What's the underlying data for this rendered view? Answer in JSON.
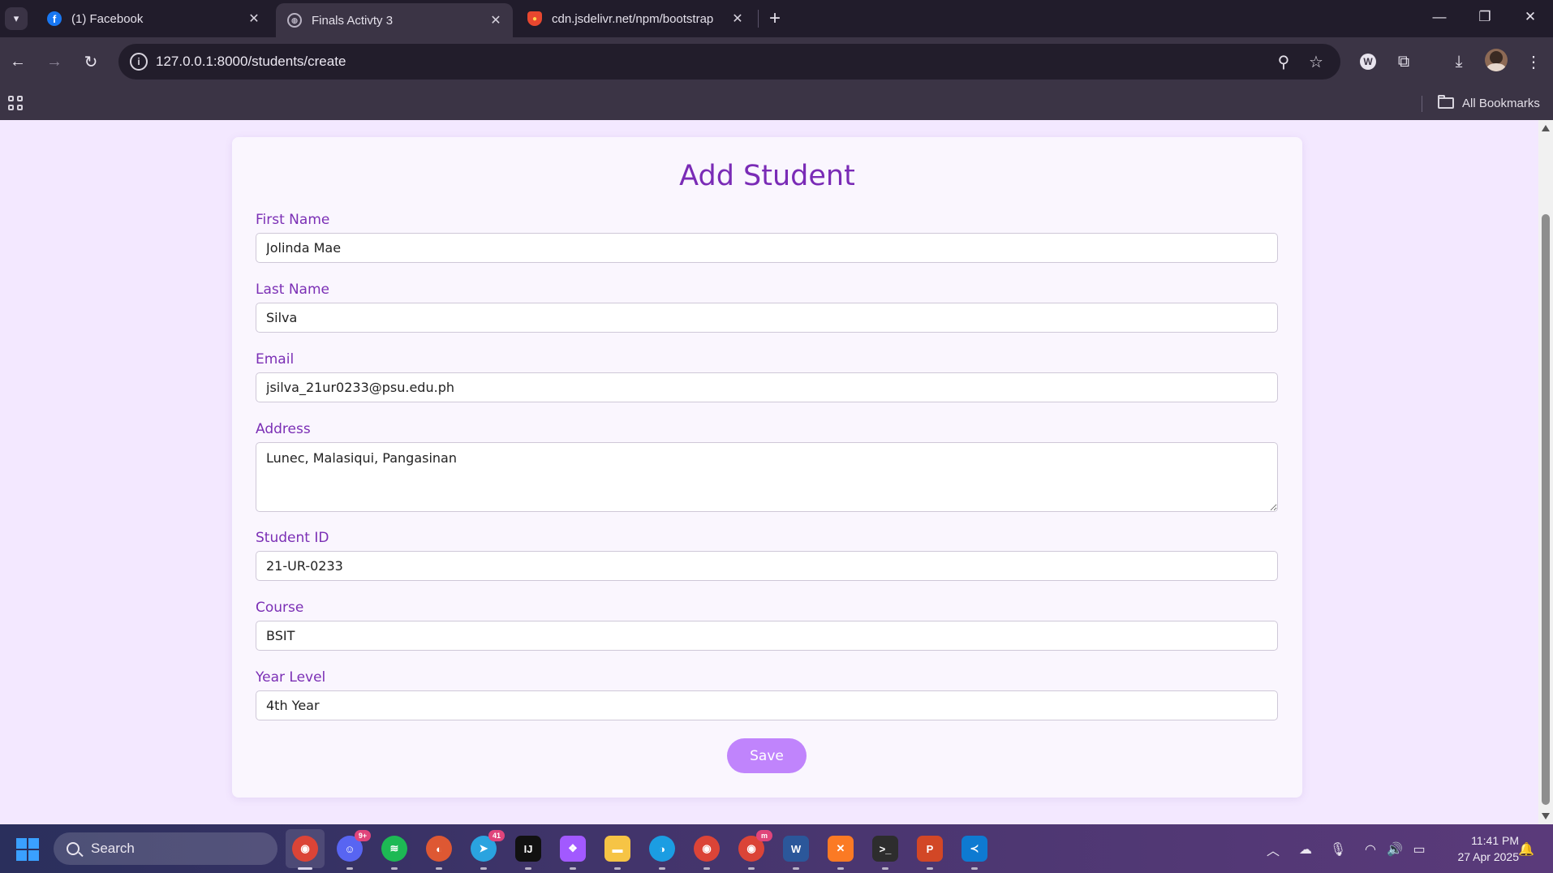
{
  "browser": {
    "tabs": [
      {
        "title": "(1) Facebook",
        "favicon": "facebook-icon",
        "favicon_color": "#1877f2"
      },
      {
        "title": "Finals Activty 3",
        "favicon": "globe-icon",
        "favicon_color": "#9a94a6"
      },
      {
        "title": "cdn.jsdelivr.net/npm/bootstrap",
        "favicon": "shield-icon",
        "favicon_color": "#e8472f"
      }
    ],
    "url": "127.0.0.1:8000/students/create",
    "bookmarks_label": "All Bookmarks"
  },
  "form": {
    "title": "Add Student",
    "fields": [
      {
        "label": "First Name",
        "value": "Jolinda Mae"
      },
      {
        "label": "Last Name",
        "value": "Silva"
      },
      {
        "label": "Email",
        "value": "jsilva_21ur0233@psu.edu.ph"
      },
      {
        "label": "Address",
        "value": "Lunec, Malasiqui, Pangasinan"
      },
      {
        "label": "Student ID",
        "value": "21-UR-0233"
      },
      {
        "label": "Course",
        "value": "BSIT"
      },
      {
        "label": "Year Level",
        "value": "4th Year"
      }
    ],
    "save_label": "Save",
    "accent_color": "#7a2bb6",
    "button_color": "#c084fc"
  },
  "taskbar": {
    "search_placeholder": "Search",
    "apps": [
      {
        "name": "chrome",
        "color": "#db4437"
      },
      {
        "name": "discord",
        "color": "#5865f2",
        "badge": "9+"
      },
      {
        "name": "spotify",
        "color": "#1db954"
      },
      {
        "name": "duckduckgo",
        "color": "#de5833"
      },
      {
        "name": "telegram",
        "color": "#2aa3df",
        "badge": "41"
      },
      {
        "name": "intellij",
        "color": "#111111"
      },
      {
        "name": "figma",
        "color": "#a259ff"
      },
      {
        "name": "file-explorer",
        "color": "#f6c445"
      },
      {
        "name": "edge",
        "color": "#1b9de2"
      },
      {
        "name": "chrome-profile-2",
        "color": "#db4437"
      },
      {
        "name": "chrome-profile-3",
        "color": "#db4437",
        "badge": "m"
      },
      {
        "name": "word",
        "color": "#2b579a"
      },
      {
        "name": "xampp",
        "color": "#fb7a24"
      },
      {
        "name": "terminal",
        "color": "#2d2d2d"
      },
      {
        "name": "powerpoint",
        "color": "#d24726"
      },
      {
        "name": "vscode",
        "color": "#0e7ad1"
      }
    ],
    "time": "11:41 PM",
    "date": "27 Apr 2025"
  }
}
